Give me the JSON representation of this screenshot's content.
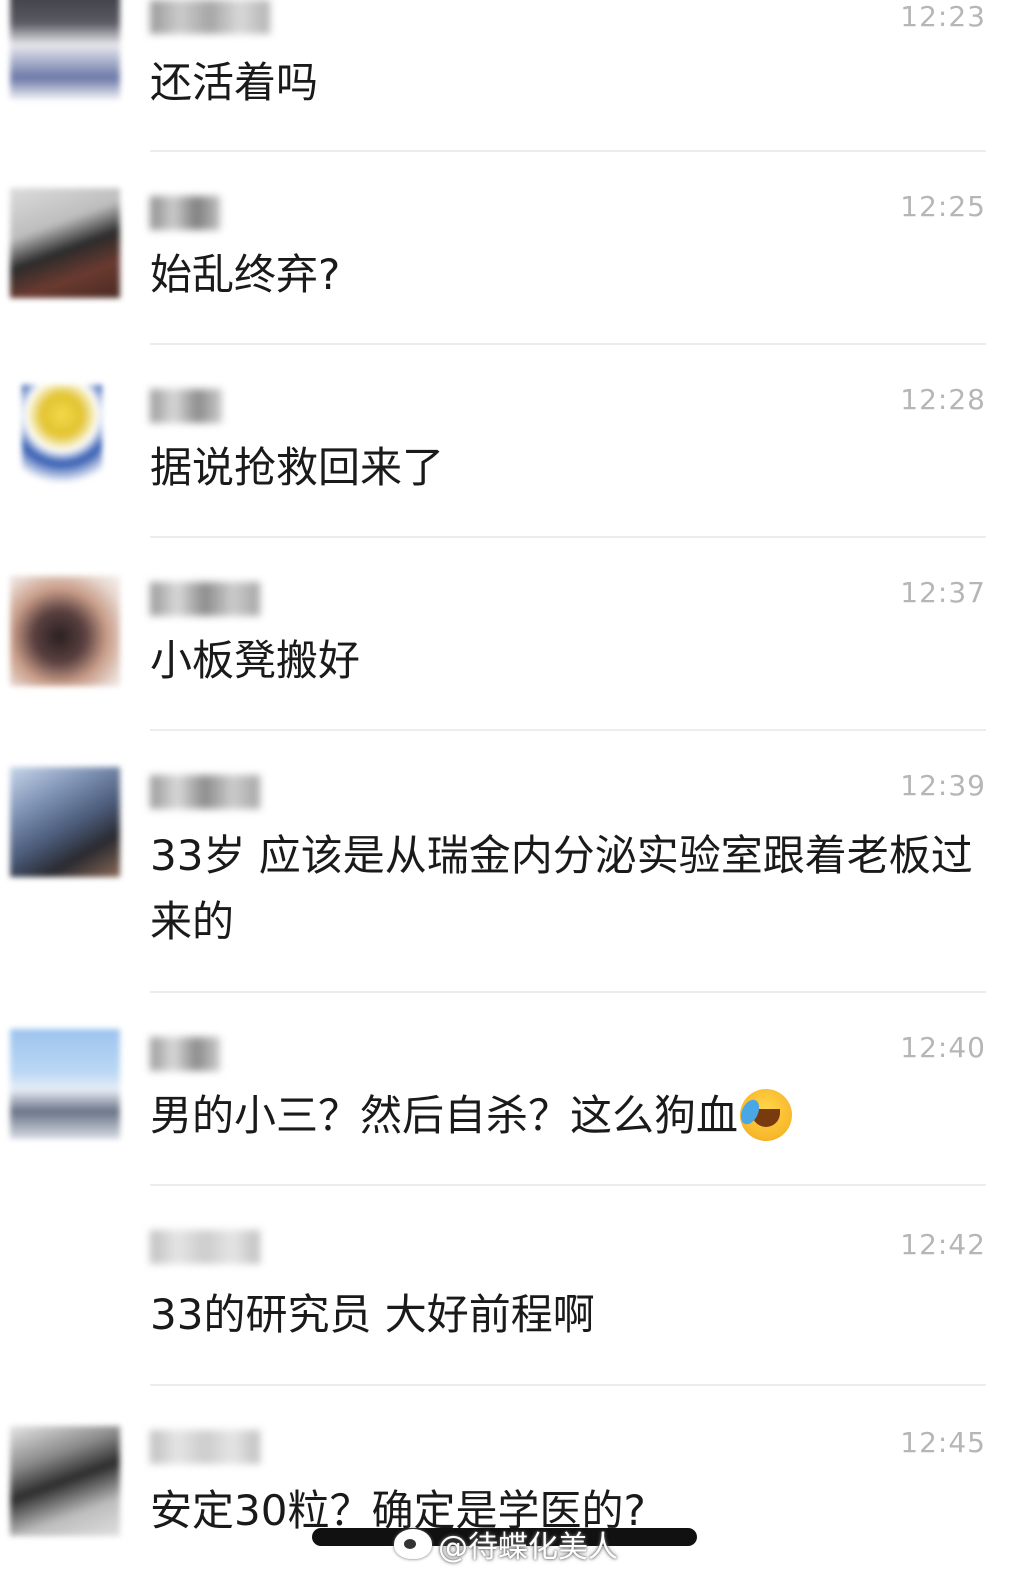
{
  "messages": [
    {
      "time": "12:23",
      "text": "还活着吗",
      "avatar": "avatar-1"
    },
    {
      "time": "12:25",
      "text": "始乱终弃?",
      "avatar": "avatar-2"
    },
    {
      "time": "12:28",
      "text": "据说抢救回来了",
      "avatar": "avatar-3"
    },
    {
      "time": "12:37",
      "text": "小板凳搬好",
      "avatar": "avatar-4"
    },
    {
      "time": "12:39",
      "text": "33岁 应该是从瑞金内分泌实验室跟着老板过来的",
      "avatar": "avatar-5"
    },
    {
      "time": "12:40",
      "text": "男的小三？然后自杀？这么狗血",
      "emoji": "laughing-crying-emoji",
      "avatar": "avatar-6"
    },
    {
      "time": "12:42",
      "text": "33的研究员 大好前程啊",
      "avatar": "none"
    },
    {
      "time": "12:45",
      "text": "安定30粒？确定是学医的?",
      "avatar": "avatar-8"
    }
  ],
  "watermark": {
    "text": "@待蝶化美人",
    "icon": "weibo-icon"
  },
  "colors": {
    "time": "#b6b6b6",
    "text": "#1a1a1a",
    "separator": "#ececec",
    "background": "#ffffff"
  }
}
